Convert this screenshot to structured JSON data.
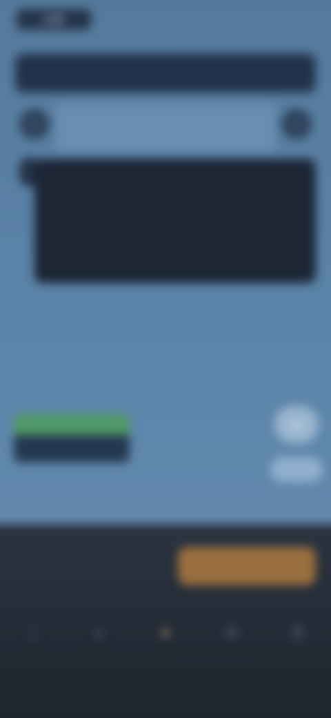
{
  "status": {
    "logo": "LIVE",
    "right": ""
  },
  "banner": {
    "text": ""
  },
  "nav": {
    "prev_icon": "chevron-left-icon",
    "next_icon": "chevron-right-icon"
  },
  "card": {
    "title": "",
    "body": "",
    "footer_left": "",
    "footer_right": ""
  },
  "left_action": {
    "label": "",
    "caption": ""
  },
  "right_actions": {
    "round_icon": "person-icon",
    "pill_label": ""
  },
  "bottom": {
    "input_placeholder": "",
    "cta_label": ""
  },
  "tabs": [
    {
      "icon": "home-icon",
      "label": ""
    },
    {
      "icon": "people-icon",
      "label": ""
    },
    {
      "icon": "star-icon",
      "label": ""
    },
    {
      "icon": "chat-icon",
      "label": ""
    },
    {
      "icon": "menu-icon",
      "label": ""
    }
  ],
  "colors": {
    "accent": "#9a6f3e",
    "green": "#4f9a66",
    "card": "#1c2634"
  }
}
